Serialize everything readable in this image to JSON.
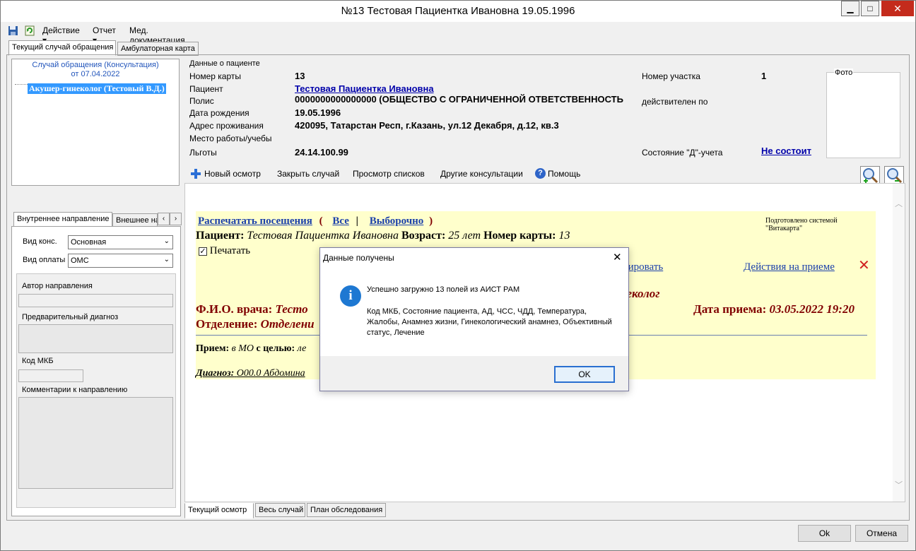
{
  "window": {
    "title": "№13 Тестовая Пациентка Ивановна 19.05.1996"
  },
  "menu": {
    "items": [
      "Действие",
      "Отчет",
      "Мед. документация"
    ]
  },
  "main_tabs": [
    "Текущий случай обращения",
    "Амбулаторная карта"
  ],
  "case_tree": {
    "header_line1": "Случай обращения (Консультация)",
    "header_line2": "от 07.04.2022",
    "item": "Акушер-гинеколог (Тестовый В.Д.)"
  },
  "patient": {
    "section_title": "Данные о пациенте",
    "card_label": "Номер карты",
    "card_value": "13",
    "patient_label": "Пациент",
    "patient_value": "Тестовая Пациентка Ивановна",
    "policy_label": "Полис",
    "policy_value": "0000000000000000 (ОБЩЕСТВО С ОГРАНИЧЕННОЙ ОТВЕТСТВЕННОСТЬ",
    "dob_label": "Дата рождения",
    "dob_value": "19.05.1996",
    "address_label": "Адрес проживания",
    "address_value": "420095, Татарстан Респ, г.Казань, ул.12 Декабря, д.12, кв.3",
    "work_label": "Место работы/учебы",
    "benefits_label": "Льготы",
    "benefits_value": "24.14.100.99",
    "district_label": "Номер участка",
    "district_value": "1",
    "valid_label": "действителен по",
    "d_status_label": "Состояние \"Д\"-учета",
    "d_status_value": "Не состоит",
    "photo_label": "Фото"
  },
  "toolbar": {
    "new_exam": "Новый осмотр",
    "close_case": "Закрыть случай",
    "view_lists": "Просмотр списков",
    "other_consults": "Другие консультации",
    "help": "Помощь"
  },
  "referral_tabs": [
    "Внутреннее направление",
    "Внешнее на"
  ],
  "referral": {
    "kind_label": "Вид конс.",
    "kind_value": "Основная",
    "pay_label": "Вид оплаты",
    "pay_value": "ОМС",
    "author_label": "Автор направления",
    "prelim_label": "Предварительный диагноз",
    "mkb_label": "Код МКБ",
    "comments_label": "Комментарии к направлению"
  },
  "document": {
    "print_visits": "Распечатать посещения",
    "open_paren": "(",
    "all": "Все",
    "sep": "|",
    "selective": "Выборочно",
    "close_paren": ")",
    "prepared_by": "Подготовлено системой \"Витакарта\"",
    "patient_label": "Пациент:",
    "patient_value": "Тестовая Пациентка Ивановна",
    "age_label": "Возраст:",
    "age_value": "25 лет",
    "card_label": "Номер карты:",
    "card_value": "13",
    "print_checkbox": "Печатать",
    "edit_fragment": "ктировать",
    "actions_link": "Действия на приеме",
    "specialty_fragment": "неколог",
    "doctor_label": "Ф.И.О. врача:",
    "doctor_fragment": "Тесто",
    "dept_label": "Отделение:",
    "dept_fragment": "Отделени",
    "date_label": "Дата приема:",
    "date_value": "03.05.2022 19:20",
    "reception_label": "Прием:",
    "reception_place": "в МО",
    "purpose_label": "с целью:",
    "purpose_fragment": "ле",
    "diagnosis_label": "Диагноз:",
    "diagnosis_fragment": "О00.0 Абдомина"
  },
  "bottom_tabs": [
    "Текущий осмотр",
    "Весь случай",
    "План обследования"
  ],
  "dialog": {
    "title": "Данные получены",
    "message": "Успешно загружно 13 полей из АИСТ РАМ",
    "details": "Код МКБ, Состояние пациента, АД, ЧСС, ЧДД, Температура, Жалобы, Анамнез жизни, Гинекологический анамнез, Объективный статус, Лечение",
    "ok": "OK"
  },
  "footer": {
    "ok": "Ok",
    "cancel": "Отмена"
  },
  "colors": {
    "link": "#0000cc",
    "doc_bg": "#ffffcc",
    "maroon": "#800000",
    "selection": "#3399ff",
    "close_red": "#c42b1c"
  }
}
